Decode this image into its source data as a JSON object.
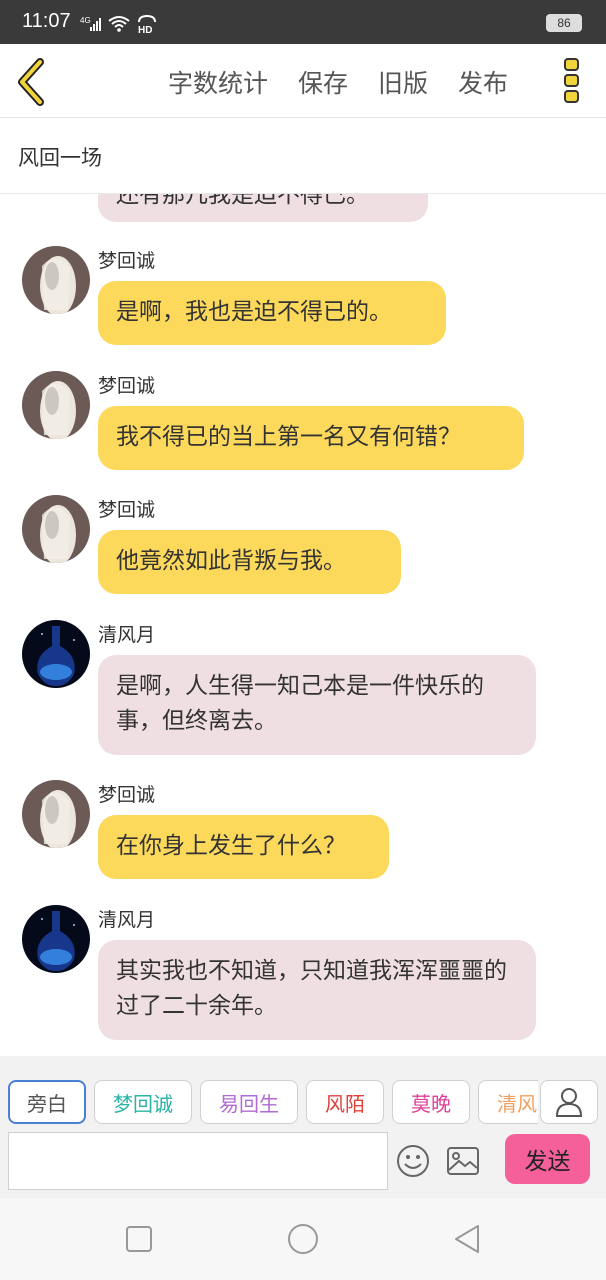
{
  "status_bar": {
    "time": "11:07",
    "network": "4G",
    "hd": "HD",
    "battery": "86"
  },
  "toolbar": {
    "back_icon": "chevron-left-icon",
    "actions": [
      "字数统计",
      "保存",
      "旧版",
      "发布"
    ],
    "more_icon": "more-vertical-icon"
  },
  "title": "风回一场",
  "partial_top_message": "还有那几我是迫不得已。",
  "messages": [
    {
      "sender": "梦回诚",
      "text": "是啊，我也是迫不得已的。",
      "color": "yellow",
      "avatar": "white-haired-figure-avatar"
    },
    {
      "sender": "梦回诚",
      "text": "我不得已的当上第一名又有何错？",
      "color": "yellow",
      "avatar": "white-haired-figure-avatar"
    },
    {
      "sender": "梦回诚",
      "text": "他竟然如此背叛与我。",
      "color": "yellow",
      "avatar": "white-haired-figure-avatar"
    },
    {
      "sender": "清风月",
      "text": "是啊，人生得一知己本是一件快乐的事，但终离去。",
      "color": "pink",
      "avatar": "blue-flask-avatar"
    },
    {
      "sender": "梦回诚",
      "text": "在你身上发生了什么？",
      "color": "yellow",
      "avatar": "white-haired-figure-avatar"
    },
    {
      "sender": "清风月",
      "text": "其实我也不知道，只知道我浑浑噩噩的过了二十余年。",
      "color": "pink",
      "avatar": "blue-flask-avatar"
    }
  ],
  "characters": [
    {
      "name": "旁白",
      "color": "#555555",
      "selected": true
    },
    {
      "name": "梦回诚",
      "color": "#2bb3a8",
      "selected": false
    },
    {
      "name": "易回生",
      "color": "#b26bd3",
      "selected": false
    },
    {
      "name": "风陌",
      "color": "#e0403a",
      "selected": false
    },
    {
      "name": "莫晚",
      "color": "#e0409a",
      "selected": false
    },
    {
      "name": "清风",
      "color": "#f0a060",
      "selected": false
    }
  ],
  "composer": {
    "input_value": "",
    "send_label": "发送",
    "emoji_icon": "smiley-icon",
    "image_icon": "image-icon",
    "person_icon": "person-icon"
  },
  "colors": {
    "yellow_bubble": "#fcd95b",
    "pink_bubble": "#efdfe2",
    "send_button": "#f5609a",
    "back_arrow": "#e6c200"
  }
}
